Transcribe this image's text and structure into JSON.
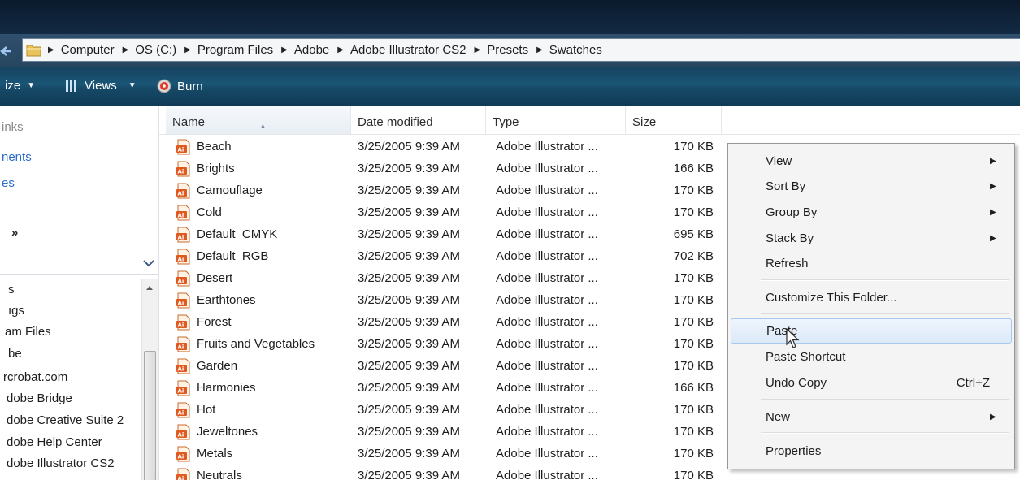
{
  "breadcrumb": [
    "Computer",
    "OS (C:)",
    "Program Files",
    "Adobe",
    "Adobe Illustrator CS2",
    "Presets",
    "Swatches"
  ],
  "toolbar": {
    "organize_label": "ize",
    "views_label": "Views",
    "burn_label": "Burn"
  },
  "nav": {
    "links": [
      "inks",
      "nents",
      "es",
      "»"
    ],
    "folders": [
      "s",
      "ıgs",
      "am Files",
      "be",
      "rcrobat.com",
      "dobe Bridge",
      "dobe Creative Suite 2",
      "dobe Help Center",
      "dobe Illustrator CS2"
    ]
  },
  "columns": {
    "name": "Name",
    "date": "Date modified",
    "type": "Type",
    "size": "Size"
  },
  "files": [
    {
      "name": "Beach",
      "date": "3/25/2005 9:39 AM",
      "type": "Adobe Illustrator ...",
      "size": "170 KB"
    },
    {
      "name": "Brights",
      "date": "3/25/2005 9:39 AM",
      "type": "Adobe Illustrator ...",
      "size": "166 KB"
    },
    {
      "name": "Camouflage",
      "date": "3/25/2005 9:39 AM",
      "type": "Adobe Illustrator ...",
      "size": "170 KB"
    },
    {
      "name": "Cold",
      "date": "3/25/2005 9:39 AM",
      "type": "Adobe Illustrator ...",
      "size": "170 KB"
    },
    {
      "name": "Default_CMYK",
      "date": "3/25/2005 9:39 AM",
      "type": "Adobe Illustrator ...",
      "size": "695 KB"
    },
    {
      "name": "Default_RGB",
      "date": "3/25/2005 9:39 AM",
      "type": "Adobe Illustrator ...",
      "size": "702 KB"
    },
    {
      "name": "Desert",
      "date": "3/25/2005 9:39 AM",
      "type": "Adobe Illustrator ...",
      "size": "170 KB"
    },
    {
      "name": "Earthtones",
      "date": "3/25/2005 9:39 AM",
      "type": "Adobe Illustrator ...",
      "size": "170 KB"
    },
    {
      "name": "Forest",
      "date": "3/25/2005 9:39 AM",
      "type": "Adobe Illustrator ...",
      "size": "170 KB"
    },
    {
      "name": "Fruits and Vegetables",
      "date": "3/25/2005 9:39 AM",
      "type": "Adobe Illustrator ...",
      "size": "170 KB"
    },
    {
      "name": "Garden",
      "date": "3/25/2005 9:39 AM",
      "type": "Adobe Illustrator ...",
      "size": "170 KB"
    },
    {
      "name": "Harmonies",
      "date": "3/25/2005 9:39 AM",
      "type": "Adobe Illustrator ...",
      "size": "166 KB"
    },
    {
      "name": "Hot",
      "date": "3/25/2005 9:39 AM",
      "type": "Adobe Illustrator ...",
      "size": "170 KB"
    },
    {
      "name": "Jeweltones",
      "date": "3/25/2005 9:39 AM",
      "type": "Adobe Illustrator ...",
      "size": "170 KB"
    },
    {
      "name": "Metals",
      "date": "3/25/2005 9:39 AM",
      "type": "Adobe Illustrator ...",
      "size": "170 KB"
    },
    {
      "name": "Neutrals",
      "date": "3/25/2005 9:39 AM",
      "type": "Adobe Illustrator ...",
      "size": "170 KB"
    }
  ],
  "context_menu": {
    "view": "View",
    "sort_by": "Sort By",
    "group_by": "Group By",
    "stack_by": "Stack By",
    "refresh": "Refresh",
    "customize": "Customize This Folder...",
    "paste": "Paste",
    "paste_shortcut": "Paste Shortcut",
    "undo_copy": "Undo Copy",
    "undo_copy_key": "Ctrl+Z",
    "new": "New",
    "properties": "Properties"
  },
  "colors": {
    "toolbar": "#1b5676",
    "address_bar": "#2f4f6e",
    "hover": "#dce9f8",
    "icon_orange": "#e05a1f"
  },
  "icons": [
    "back-arrow-icon",
    "folder-icon",
    "chevron-right-icon",
    "views-icon",
    "burn-icon",
    "illustrator-file-icon",
    "submenu-arrow-icon",
    "mouse-cursor-icon"
  ]
}
